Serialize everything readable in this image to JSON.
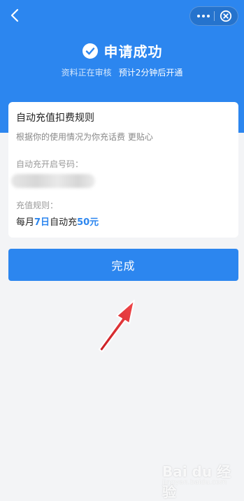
{
  "header": {
    "title": "申请成功",
    "subtitle_status": "资料正在审核",
    "subtitle_eta": "预计2分钟后开通"
  },
  "card": {
    "title": "自动充值扣费规则",
    "description": "根据你的使用情况为你充话费 更贴心",
    "number_label": "自动充开启号码：",
    "rule_label": "充值规则：",
    "rule": {
      "prefix": "每月",
      "day": "7日",
      "middle": "自动充",
      "amount": "50元"
    }
  },
  "actions": {
    "done_label": "完成"
  },
  "watermark": {
    "brand": "Bai du 经验",
    "url": "jingyan.baidu.com"
  },
  "colors": {
    "primary": "#2c86ef",
    "annotation_arrow": "#e0262b"
  }
}
